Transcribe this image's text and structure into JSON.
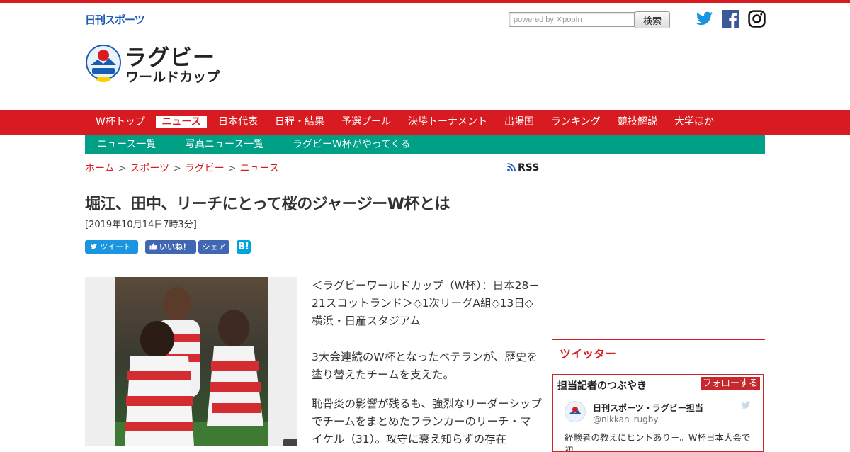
{
  "site": {
    "brand": "日刊スポーツ",
    "section_title_line1": "ラグビー",
    "section_title_line2": "ワールドカップ"
  },
  "search": {
    "placeholder": "powered by ✕popIn",
    "button_label": "検索"
  },
  "social_links": [
    "twitter-icon",
    "facebook-icon",
    "instagram-icon"
  ],
  "main_nav": {
    "items": [
      {
        "label": "W杯トップ"
      },
      {
        "label": "ニュース",
        "active": true
      },
      {
        "label": "日本代表"
      },
      {
        "label": "日程・結果"
      },
      {
        "label": "予選プール"
      },
      {
        "label": "決勝トーナメント"
      },
      {
        "label": "出場国"
      },
      {
        "label": "ランキング"
      },
      {
        "label": "競技解説"
      },
      {
        "label": "大学ほか"
      }
    ]
  },
  "sub_nav": {
    "items": [
      {
        "label": "ニュース一覧"
      },
      {
        "label": "写真ニュース一覧"
      },
      {
        "label": "ラグビーW杯がやってくる"
      }
    ]
  },
  "breadcrumb": {
    "items": [
      "ホーム",
      "スポーツ",
      "ラグビー",
      "ニュース"
    ],
    "separator": ">"
  },
  "rss_label": "RSS",
  "article": {
    "title": "堀江、田中、リーチにとって桜のジャージーW杯とは",
    "date": "[2019年10月14日7時3分]",
    "paragraphs": [
      "＜ラグビーワールドカップ（W杯）：日本28－21スコットランド＞◇1次リーグA組◇13日◇横浜・日産スタジアム",
      "3大会連続のW杯となったベテランが、歴史を塗り替えたチームを支えた。",
      "恥骨炎の影響が残るも、強烈なリーダーシップでチームをまとめたフランカーのリーチ・マイケル（31）。攻守に衰え知らずの存在"
    ]
  },
  "share": {
    "tweet": "ツイート",
    "like": "いいね！",
    "fb_share": "シェア",
    "hatena": "B!"
  },
  "colors": {
    "brand_red": "#d81b21",
    "sub_nav_green": "#00a087",
    "twitter_blue": "#1b95e0",
    "facebook_blue": "#4267b2"
  },
  "sidebar": {
    "heading": "ツイッター",
    "widget": {
      "title": "担当記者のつぶやき",
      "follow_label": "フォローする",
      "account_name": "日刊スポーツ・ラグビー担当",
      "handle": "@nikkan_rugby",
      "tweet_text": "経験者の教えにヒントあり－。W杯日本大会で初"
    }
  }
}
